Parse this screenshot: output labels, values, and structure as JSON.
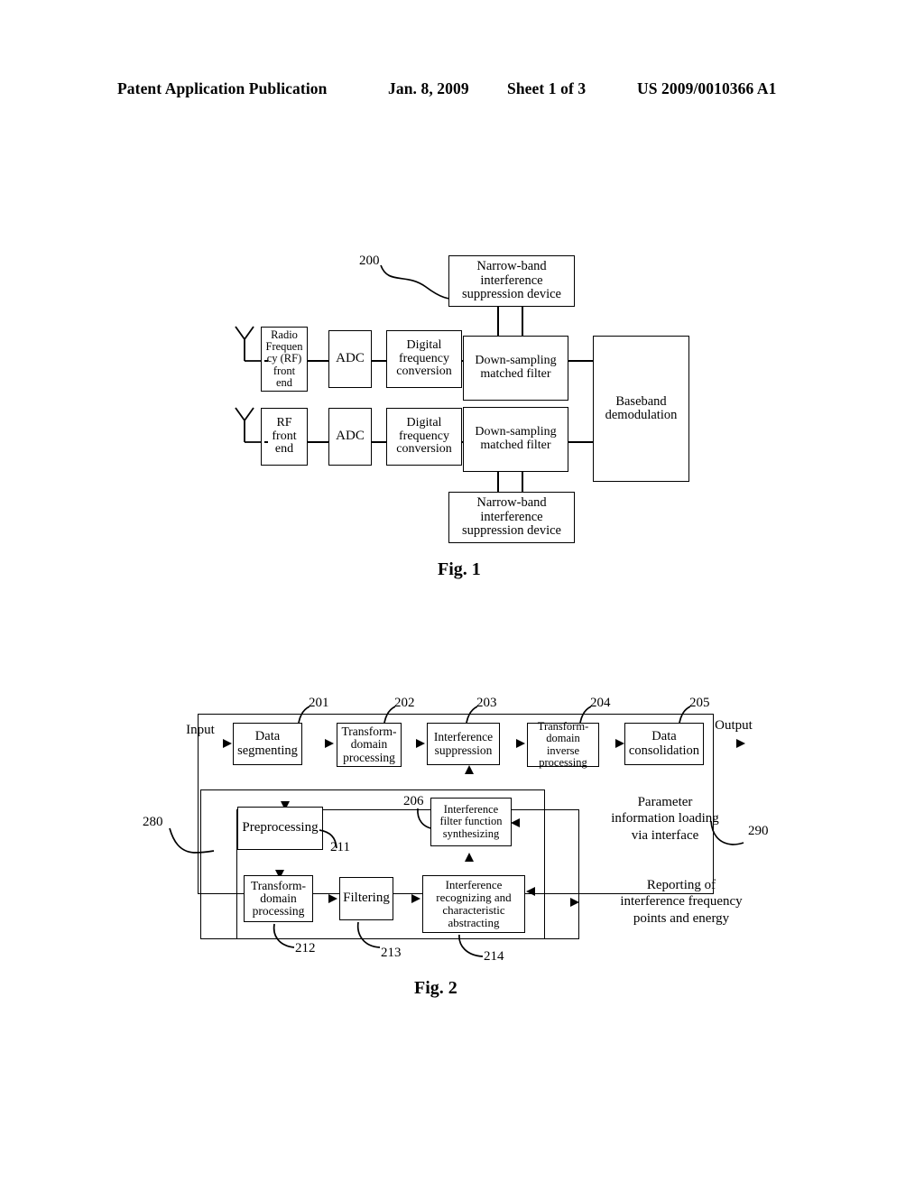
{
  "header": {
    "publication": "Patent Application Publication",
    "date": "Jan. 8, 2009",
    "sheet": "Sheet 1 of 3",
    "number": "US 2009/0010366 A1"
  },
  "figure1": {
    "caption": "Fig. 1",
    "ref_200": "200",
    "blocks": {
      "nbi_top": "Narrow-band\ninterference\nsuppression device",
      "nbi_bottom": "Narrow-band\ninterference\nsuppression device",
      "rf_front_end_1": "Radio\nFrequen\ncy (RF)\nfront\nend",
      "rf_front_end_2": "RF\nfront\nend",
      "adc_1": "ADC",
      "adc_2": "ADC",
      "dfc_1": "Digital\nfrequency\nconversion",
      "dfc_2": "Digital\nfrequency\nconversion",
      "dsmf_1": "Down-sampling\nmatched filter",
      "dsmf_2": "Down-sampling\nmatched filter",
      "baseband": "Baseband\ndemodulation"
    }
  },
  "figure2": {
    "caption": "Fig. 2",
    "io": {
      "input": "Input",
      "output": "Output"
    },
    "refs": {
      "r201": "201",
      "r202": "202",
      "r203": "203",
      "r204": "204",
      "r205": "205",
      "r206": "206",
      "r211": "211",
      "r212": "212",
      "r213": "213",
      "r214": "214",
      "r280": "280",
      "r290": "290"
    },
    "blocks": {
      "data_segmenting": "Data\nsegmenting",
      "transform_domain_processing": "Transform-\ndomain\nprocessing",
      "interference_suppression": "Interference\nsuppression",
      "transform_domain_inverse_processing": "Transform-\ndomain inverse\nprocessing",
      "data_consolidation": "Data\nconsolidation",
      "preprocessing": "Preprocessing",
      "interference_filter_function_synthesizing": "Interference\nfilter function\nsynthesizing",
      "transform_domain_processing_2": "Transform-\ndomain\nprocessing",
      "filtering": "Filtering",
      "interference_recognizing": "Interference\nrecognizing and\ncharacteristic\nabstracting"
    },
    "annotations": {
      "parameter_loading": "Parameter\ninformation loading\nvia interface",
      "reporting": "Reporting of\ninterference frequency\npoints and energy"
    }
  },
  "colors": {
    "ink": "#000000",
    "paper": "#ffffff"
  }
}
